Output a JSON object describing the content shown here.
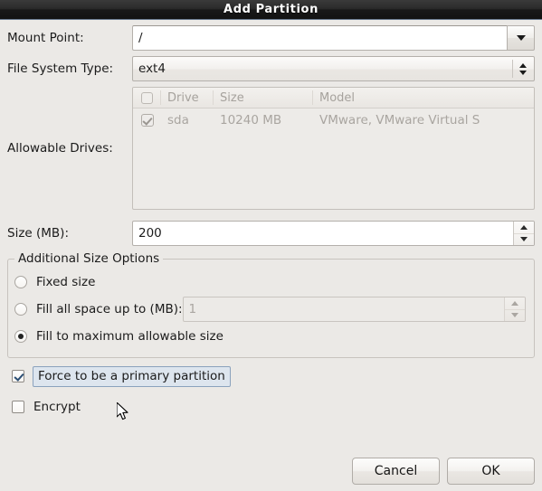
{
  "window": {
    "title": "Add Partition"
  },
  "form": {
    "mount_point": {
      "label": "Mount Point:",
      "value": "/",
      "dropdown_icon": "chevron-down-icon"
    },
    "file_system_type": {
      "label": "File System Type:",
      "value": "ext4",
      "stepper_icon": "up-down-chevron-icon"
    },
    "allowable_drives": {
      "label": "Allowable Drives:",
      "columns": [
        "",
        "Drive",
        "Size",
        "Model"
      ],
      "header_select_all_icon": "checkbox-empty-icon",
      "rows": [
        {
          "selected": true,
          "drive": "sda",
          "size": "10240 MB",
          "model": "VMware, VMware Virtual S"
        }
      ]
    },
    "size": {
      "label": "Size (MB):",
      "value": "200"
    },
    "additional_size_options": {
      "legend": "Additional Size Options",
      "options": [
        {
          "label": "Fixed size",
          "selected": false
        },
        {
          "label": "Fill all space up to (MB):",
          "selected": false,
          "spin_value": "1",
          "spin_disabled": true
        },
        {
          "label": "Fill to maximum allowable size",
          "selected": true
        }
      ]
    },
    "force_primary": {
      "label": "Force to be a primary partition",
      "checked": true,
      "focused": true
    },
    "encrypt": {
      "label": "Encrypt",
      "checked": false
    }
  },
  "actions": {
    "cancel_label": "Cancel",
    "ok_label": "OK"
  },
  "colors": {
    "dialog_background": "#ebe9e6",
    "titlebar_dark": "#1a1a1a",
    "titlebar_accent": "#6a7b90",
    "focus_fill": "#dde5ee",
    "focus_border": "#8ba2bd",
    "disabled_text": "#a9a5a0"
  }
}
